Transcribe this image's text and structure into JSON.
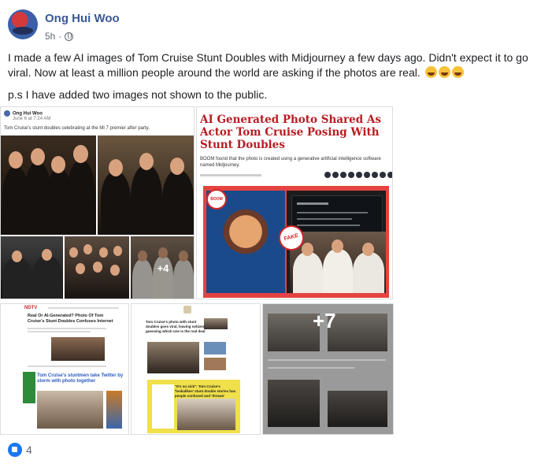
{
  "post": {
    "author": "Ong Hui Woo",
    "time": "5h",
    "separator": "·",
    "text_line1": "I made a few AI images of Tom Cruise Stunt Doubles with Midjourney a few days ago. Didn't expect it to go viral. Now at least a million people around the world are asking if the photos are real.",
    "text_line2": "p.s I have added two images not shown to the public.",
    "emoji": [
      "laughing-emoji",
      "laughing-emoji",
      "laughing-emoji"
    ]
  },
  "gallery": {
    "tile1": {
      "author": "Ong Hui Woo",
      "time": "June 6 at 7:24 AM",
      "caption": "Tom Cruise's stunt doubles celebrating at the MI 7 premier after party.",
      "more_count": "+4"
    },
    "tile2": {
      "headline": "AI Generated Photo Shared As Actor Tom Cruise Posing With Stunt Doubles",
      "subtitle": "BOOM found that the photo is created using a generative artificial intelligence software named Midjourney.",
      "badge_fake": "FAKE",
      "badge_boom": "BOOM"
    },
    "tile3": {
      "site": "NDTV",
      "headline1": "Real Or AI-Generated? Photo Of Tom Cruise's Stunt Doubles Confuses Internet",
      "headline2": "Tom Cruise's stuntmen take Twitter by storm with photo together"
    },
    "tile4": {
      "headline1": "Tom Cruise's photo with stunt doubles goes viral, leaving netizens guessing which one is the real deal",
      "headline2": "\"It's so sick\": Tom Cruise's 'lookalikes' stunt double stories has people confused and 'thrown'"
    },
    "tile5": {
      "more_count": "+7"
    }
  },
  "reactions": {
    "like_count": "4"
  },
  "colors": {
    "author_link": "#385898",
    "like_blue": "#1877f2",
    "headline_red": "#b81c22"
  }
}
